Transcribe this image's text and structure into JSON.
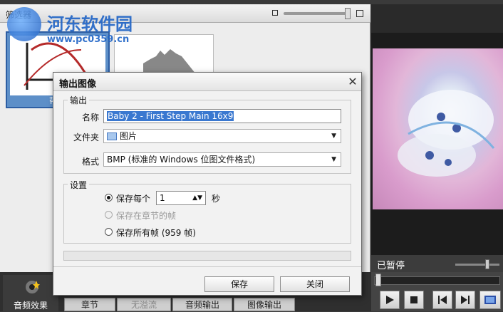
{
  "background": {
    "filter_panel_title": "筛选器",
    "filter_thumbnails": [
      {
        "label": "带通"
      }
    ],
    "preview_status": "已暂停",
    "bottom_tabs": {
      "audio_effects": "音频效果",
      "chapters": "章节",
      "no_chapters": "无溢流",
      "audio_output": "音频输出",
      "image_output": "图像输出"
    }
  },
  "watermark": {
    "title": "河东软件园",
    "url": "www.pc0359.cn"
  },
  "dialog": {
    "title": "输出图像",
    "close_icon": "close-icon",
    "output_group": {
      "title": "输出",
      "name_label": "名称",
      "name_value": "Baby 2 - First Step Main 16x9",
      "folder_label": "文件夹",
      "folder_value": "图片",
      "format_label": "格式",
      "format_value": "BMP (标准的 Windows 位图文件格式)"
    },
    "settings_group": {
      "title": "设置",
      "options": [
        {
          "label": "保存每个",
          "selected": true,
          "enabled": true
        },
        {
          "label": "保存在章节的帧",
          "selected": false,
          "enabled": false
        },
        {
          "label": "保存所有帧 (959 帧)",
          "selected": false,
          "enabled": true
        }
      ],
      "interval_value": "1",
      "interval_unit": "秒"
    },
    "buttons": {
      "save": "保存",
      "close": "关闭"
    }
  },
  "colors": {
    "accent": "#3a78d0",
    "selection": "#5d8fc8",
    "background_dark": "#2f2f2f"
  }
}
